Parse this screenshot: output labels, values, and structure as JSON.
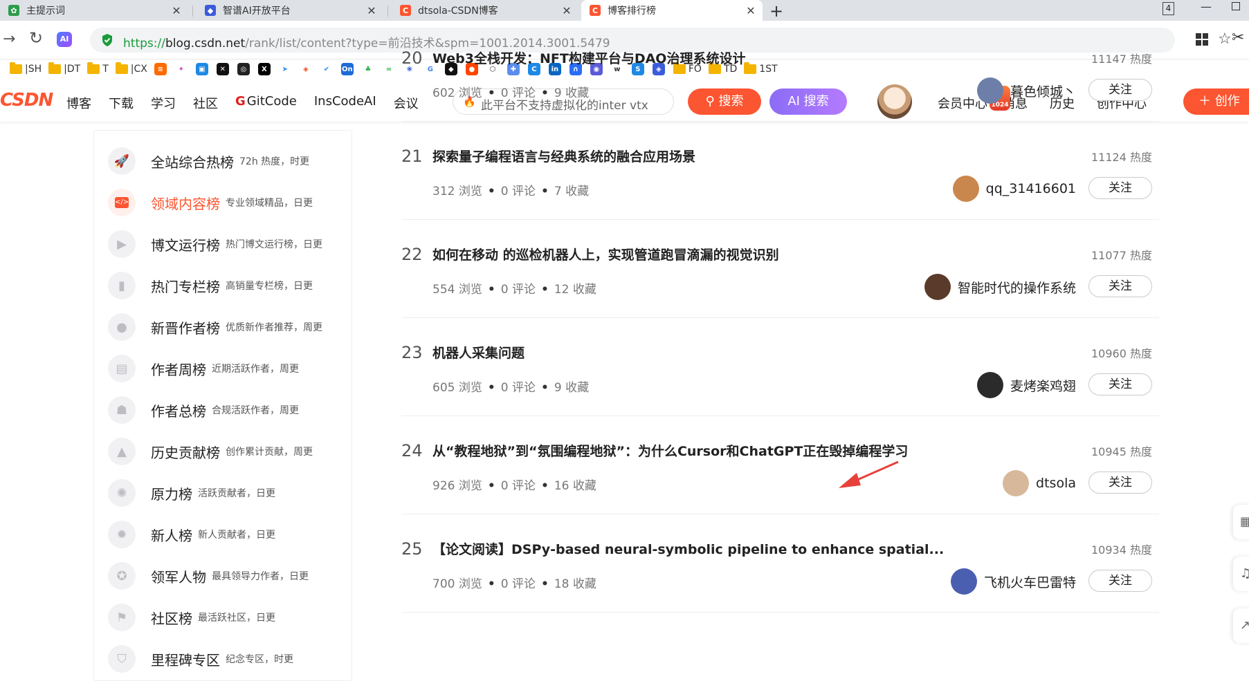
{
  "browser": {
    "tabs": [
      {
        "title": "主提示词",
        "icon": "leaf-icon",
        "color": "#2d9c4a"
      },
      {
        "title": "智谱AI开放平台",
        "icon": "zhipu-icon",
        "color": "#3b5bdb"
      },
      {
        "title": "dtsola-CSDN博客",
        "icon": "csdn-c-icon",
        "color": "#fc5531"
      },
      {
        "title": "博客排行榜",
        "icon": "csdn-c-icon",
        "color": "#fc5531"
      }
    ],
    "tab_count": "4",
    "url_proto": "https://",
    "url_host": "blog.csdn.net",
    "url_path": "/rank/list/content?type=前沿技术&spm=1001.2014.3001.5479",
    "bookmarks": [
      "|SH",
      "|DT",
      "T",
      "|CX"
    ],
    "bookmarks_right": [
      "FO",
      "TD",
      "1ST"
    ]
  },
  "header": {
    "logo": "CSDN",
    "nav": [
      "博客",
      "下载",
      "学习",
      "社区",
      "GitCode",
      "InsCodeAI",
      "会议"
    ],
    "search_placeholder": "此平台不支持虚拟化的inter vtx",
    "search_button": "搜索",
    "ai_search_button": "AI 搜索",
    "links": [
      "会员中心",
      "消息",
      "历史",
      "创作中心"
    ],
    "vip_badge": "1024",
    "create_button": "创作"
  },
  "sidebar": [
    {
      "name": "全站综合热榜",
      "desc": "72h 热度，时更",
      "icon": "rocket-icon",
      "active": false
    },
    {
      "name": "领域内容榜",
      "desc": "专业领域精品，日更",
      "icon": "code-icon",
      "active": true
    },
    {
      "name": "博文运行榜",
      "desc": "热门博文运行榜，日更",
      "icon": "play-icon",
      "active": false
    },
    {
      "name": "热门专栏榜",
      "desc": "高销量专栏榜，日更",
      "icon": "book-icon",
      "active": false
    },
    {
      "name": "新晋作者榜",
      "desc": "优质新作者推荐，周更",
      "icon": "user-icon",
      "active": false
    },
    {
      "name": "作者周榜",
      "desc": "近期活跃作者，周更",
      "icon": "calendar-icon",
      "active": false
    },
    {
      "name": "作者总榜",
      "desc": "合规活跃作者，周更",
      "icon": "users-icon",
      "active": false
    },
    {
      "name": "历史贡献榜",
      "desc": "创作累计贡献，周更",
      "icon": "mountain-icon",
      "active": false
    },
    {
      "name": "原力榜",
      "desc": "活跃贡献者，日更",
      "icon": "badge-icon",
      "active": false
    },
    {
      "name": "新人榜",
      "desc": "新人贡献者，日更",
      "icon": "newbie-icon",
      "active": false
    },
    {
      "name": "领军人物",
      "desc": "最具领导力作者，日更",
      "icon": "medal-icon",
      "active": false
    },
    {
      "name": "社区榜",
      "desc": "最活跃社区，日更",
      "icon": "flag-icon",
      "active": false
    },
    {
      "name": "里程碑专区",
      "desc": "纪念专区，时更",
      "icon": "milestone-icon",
      "active": false
    }
  ],
  "ranks": [
    {
      "num": "20",
      "title": "Web3全栈开发：NFT构建平台与DAO治理系统设计",
      "heat": "11147 热度",
      "views": "602 浏览",
      "comments": "0 评论",
      "favs": "9 收藏",
      "author": "暮色倾城丶",
      "avatar_color": "#6d7fa8",
      "follow": "关注"
    },
    {
      "num": "21",
      "title": "探索量子编程语言与经典系统的融合应用场景",
      "heat": "11124 热度",
      "views": "312 浏览",
      "comments": "0 评论",
      "favs": "7 收藏",
      "author": "qq_31416601",
      "avatar_color": "#c9874d",
      "follow": "关注"
    },
    {
      "num": "22",
      "title": "如何在移动 的巡检机器人上，实现管道跑冒滴漏的视觉识别",
      "heat": "11077 热度",
      "views": "554 浏览",
      "comments": "0 评论",
      "favs": "12 收藏",
      "author": "智能时代的操作系统",
      "avatar_color": "#5a3a2a",
      "follow": "关注"
    },
    {
      "num": "23",
      "title": "机器人采集问题",
      "heat": "10960 热度",
      "views": "605 浏览",
      "comments": "0 评论",
      "favs": "9 收藏",
      "author": "麦烤楽鸡翅",
      "avatar_color": "#2b2b2b",
      "follow": "关注"
    },
    {
      "num": "24",
      "title": "从“教程地狱”到“氛围编程地狱”：为什么Cursor和ChatGPT正在毁掉编程学习",
      "heat": "10945 热度",
      "views": "926 浏览",
      "comments": "0 评论",
      "favs": "16 收藏",
      "author": "dtsola",
      "avatar_color": "#d8b89a",
      "follow": "关注"
    },
    {
      "num": "25",
      "title": "【论文阅读】DSPy-based neural-symbolic pipeline to enhance spatial...",
      "heat": "10934 热度",
      "views": "700 浏览",
      "comments": "0 评论",
      "favs": "18 收藏",
      "author": "飞机火车巴雷特",
      "avatar_color": "#4b5fb0",
      "follow": "关注"
    }
  ],
  "annotation_color": "#e8403a"
}
